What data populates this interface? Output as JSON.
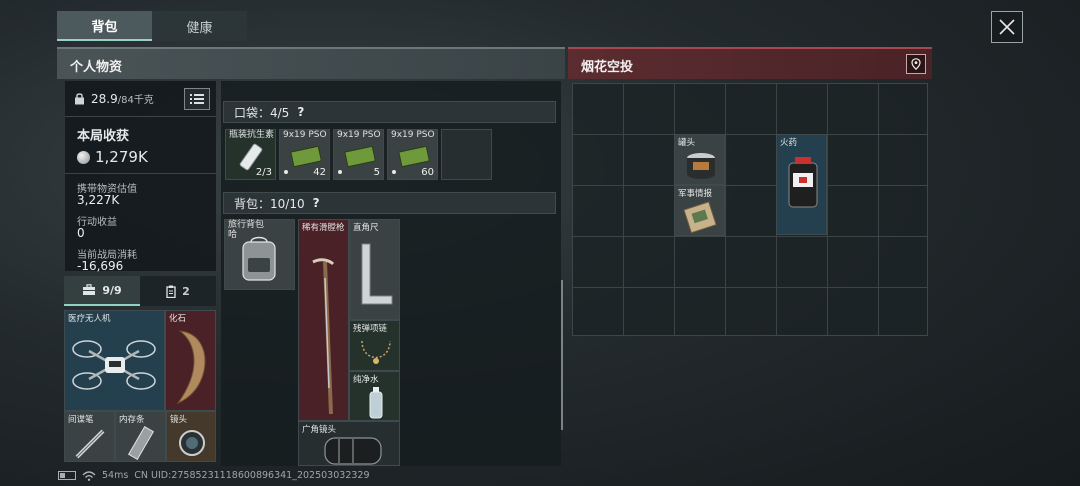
{
  "tabs": [
    {
      "label": "背包"
    },
    {
      "label": "健康"
    }
  ],
  "left_header": {
    "title": "个人物资"
  },
  "right_header": {
    "title": "烟花空投"
  },
  "stats": {
    "weight": "28.9",
    "weight_max": "/84千克",
    "harvest_title": "本局收获",
    "harvest_value": "1,279K",
    "carry_label": "携带物资估值",
    "carry_value": "3,227K",
    "action_label": "行动收益",
    "action_value": "0",
    "cost_label": "当前战局消耗",
    "cost_value": "-16,696"
  },
  "bottom_tabs": [
    {
      "label": "9/9"
    },
    {
      "label": "2"
    }
  ],
  "safebox_items": [
    {
      "name": "医疗无人机",
      "rarity": "blue"
    },
    {
      "name": "化石",
      "rarity": "red"
    },
    {
      "name": "间谍笔",
      "rarity": "grey"
    },
    {
      "name": "内存条",
      "rarity": "grey"
    },
    {
      "name": "镜头",
      "rarity": "gold"
    }
  ],
  "pocket": {
    "label": "口袋：4/5",
    "help": "?",
    "slots": [
      {
        "name": "瓶装抗生素",
        "count": "2/3"
      },
      {
        "name": "9x19 PSO",
        "count": "42"
      },
      {
        "name": "9x19 PSO",
        "count": "5"
      },
      {
        "name": "9x19 PSO",
        "count": "60"
      }
    ]
  },
  "backpack": {
    "label": "背包：10/10",
    "help": "?",
    "pack_name": "旅行背包 哈",
    "items": [
      {
        "name": "稀有滑膛枪",
        "rarity": "red"
      },
      {
        "name": "直角尺",
        "rarity": "grey"
      },
      {
        "name": "残弹项链",
        "rarity": "green"
      },
      {
        "name": "纯净水",
        "rarity": "green"
      },
      {
        "name": "广角镜头",
        "rarity": "dark"
      }
    ]
  },
  "airdrop": {
    "items": [
      {
        "name": "罐头",
        "rarity": "grey"
      },
      {
        "name": "军事情报",
        "rarity": "grey"
      },
      {
        "name": "火药",
        "rarity": "blue"
      }
    ]
  },
  "status": {
    "ping": "54ms",
    "uid": "CN UID:2758523111860089634​1_202503032329"
  }
}
